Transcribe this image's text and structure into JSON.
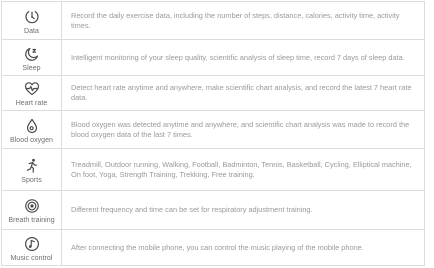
{
  "features": [
    {
      "label": "Data",
      "icon": "steps-gauge-icon",
      "description": "Record the daily exercise data, including the number of steps, distance, calories, activity time, activity times."
    },
    {
      "label": "Sleep",
      "icon": "moon-sleep-icon",
      "description": "Intelligent monitoring of your sleep quality, scientific analysis of sleep time, record 7 days of sleep data."
    },
    {
      "label": "Heart rate",
      "icon": "heart-rate-icon",
      "description": "Detect heart rate anytime and anywhere, make scientific chart analysis, and record the latest 7 heart rate data."
    },
    {
      "label": "Blood oxygen",
      "icon": "blood-drop-icon",
      "description": "Blood oxygen was detected anytime and anywhere, and scientific chart analysis was made to record the blood oxygen data of the last 7 times."
    },
    {
      "label": "Sports",
      "icon": "running-person-icon",
      "description": "Treadmill, Outdoor running, Walking, Football, Badminton, Tennis, Basketball, Cycling, Elliptical machine, On foot, Yoga, Strength Training, Trekking, Free training."
    },
    {
      "label": "Breath training",
      "icon": "breath-circle-icon",
      "description": "Different frequency and time can be set for respiratory adjustment training."
    },
    {
      "label": "Music control",
      "icon": "music-note-icon",
      "description": "After connecting the mobile phone, you can control the music playing of the mobile phone."
    }
  ]
}
